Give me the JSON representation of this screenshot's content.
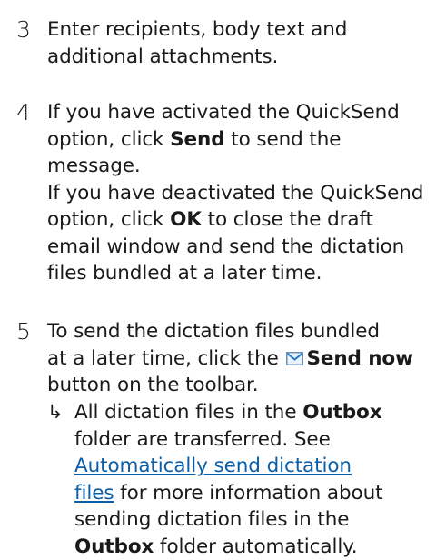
{
  "step3": {
    "number": "3",
    "line1": "Enter recipients, body text and",
    "line2": "additional attachments."
  },
  "step4": {
    "number": "4",
    "line1": "If you have activated the QuickSend",
    "line2_pre": "option, click ",
    "line2_bold": "Send",
    "line2_post": " to send the",
    "line3": "message.",
    "line4": "If you have deactivated the QuickSend",
    "line5_pre": "option, click ",
    "line5_bold": "OK",
    "line5_post": " to close the draft",
    "line6": "email window and send the dictation",
    "line7": "files bundled at a later time."
  },
  "step5": {
    "number": "5",
    "line1": "To send the dictation files bundled",
    "line2_pre": "at a later time, click the ",
    "line2_bold": "Send now",
    "line3": "button on the toolbar.",
    "icon": "envelope-icon"
  },
  "result": {
    "arrow": "↳",
    "line1_pre": "All dictation files in the ",
    "line1_bold": "Outbox",
    "line2": "folder are transferred. See",
    "link_line1": "Automatically send dictation",
    "link_line2": "files",
    "line3_post": " for more information about",
    "line4": "sending dictation files in the",
    "line5_bold": "Outbox",
    "line5_post": " folder automatically.",
    "link_color": "#0b5ea8"
  }
}
